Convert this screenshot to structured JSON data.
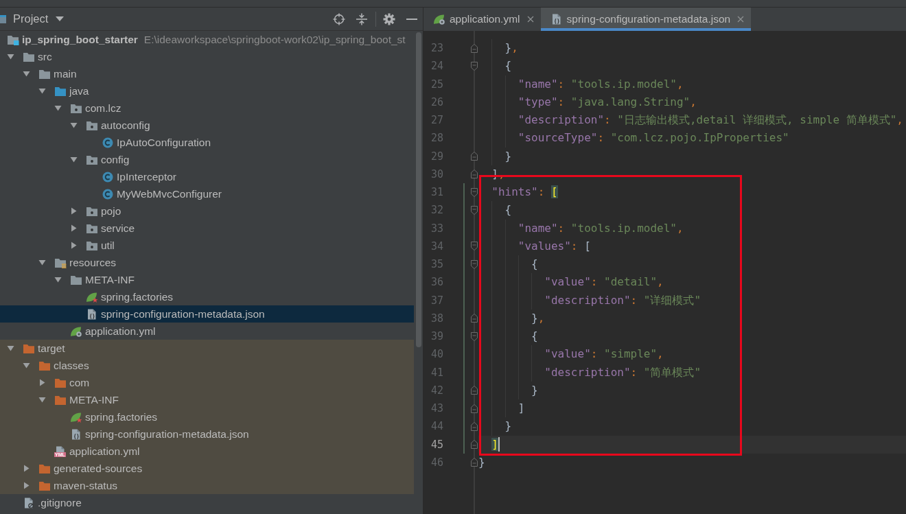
{
  "project_panel": {
    "title": "Project",
    "tools": [
      {
        "kind": "locate"
      },
      {
        "kind": "collapse"
      },
      {
        "kind": "separator"
      },
      {
        "kind": "settings"
      },
      {
        "kind": "hide"
      }
    ]
  },
  "tree": [
    {
      "kind": "module",
      "label": "ip_spring_boot_starter",
      "path": "E:\\ideaworkspace\\springboot-work02\\ip_spring_boot_st",
      "selected": false,
      "children": [
        {
          "kind": "folder",
          "label": "src",
          "expanded": true,
          "excluded": false,
          "selected": false,
          "children": [
            {
              "kind": "folder",
              "label": "main",
              "expanded": true,
              "selected": false,
              "children": [
                {
                  "kind": "source-folder",
                  "label": "java",
                  "expanded": true,
                  "selected": false,
                  "children": [
                    {
                      "kind": "package",
                      "label": "com.lcz",
                      "expanded": true,
                      "selected": false,
                      "children": [
                        {
                          "kind": "package",
                          "label": "autoconfig",
                          "expanded": true,
                          "selected": false,
                          "children": [
                            {
                              "kind": "class",
                              "label": "IpAutoConfiguration",
                              "selected": false
                            }
                          ]
                        },
                        {
                          "kind": "package",
                          "label": "config",
                          "expanded": true,
                          "selected": false,
                          "children": [
                            {
                              "kind": "class",
                              "label": "IpInterceptor",
                              "selected": false
                            },
                            {
                              "kind": "class",
                              "label": "MyWebMvcConfigurer",
                              "selected": false
                            }
                          ]
                        },
                        {
                          "kind": "package",
                          "label": "pojo",
                          "expanded": false,
                          "selected": false
                        },
                        {
                          "kind": "package",
                          "label": "service",
                          "expanded": false,
                          "selected": false
                        },
                        {
                          "kind": "package",
                          "label": "util",
                          "expanded": false,
                          "selected": false
                        }
                      ]
                    }
                  ]
                },
                {
                  "kind": "resources-folder",
                  "label": "resources",
                  "expanded": true,
                  "selected": false,
                  "children": [
                    {
                      "kind": "folder",
                      "label": "META-INF",
                      "expanded": true,
                      "selected": false,
                      "children": [
                        {
                          "kind": "spring-factories",
                          "label": "spring.factories",
                          "selected": false
                        },
                        {
                          "kind": "json",
                          "label": "spring-configuration-metadata.json",
                          "selected": true
                        }
                      ]
                    },
                    {
                      "kind": "spring-yml",
                      "label": "application.yml",
                      "selected": false
                    }
                  ]
                }
              ]
            }
          ]
        },
        {
          "kind": "excluded-folder",
          "label": "target",
          "expanded": true,
          "excluded": true,
          "selected": false,
          "children": [
            {
              "kind": "excluded-folder",
              "label": "classes",
              "expanded": true,
              "selected": false,
              "children": [
                {
                  "kind": "excluded-folder",
                  "label": "com",
                  "expanded": false,
                  "selected": false
                },
                {
                  "kind": "excluded-folder",
                  "label": "META-INF",
                  "expanded": true,
                  "selected": false,
                  "children": [
                    {
                      "kind": "spring-factories",
                      "label": "spring.factories",
                      "selected": false
                    },
                    {
                      "kind": "json",
                      "label": "spring-configuration-metadata.json",
                      "selected": false
                    }
                  ]
                },
                {
                  "kind": "yml",
                  "label": "application.yml",
                  "badge": "YML",
                  "selected": false
                }
              ]
            },
            {
              "kind": "excluded-folder",
              "label": "generated-sources",
              "expanded": false,
              "selected": false
            },
            {
              "kind": "excluded-folder",
              "label": "maven-status",
              "expanded": false,
              "selected": false
            }
          ]
        },
        {
          "kind": "gitignore",
          "label": ".gitignore",
          "excluded": false,
          "selected": false
        }
      ]
    }
  ],
  "editor": {
    "tabs": [
      {
        "label": "application.yml",
        "kind": "spring-yml",
        "selected": false
      },
      {
        "label": "spring-configuration-metadata.json",
        "kind": "json",
        "selected": true
      }
    ],
    "lines": [
      {
        "children": [
          {
            "framed": false,
            "changed": false,
            "children": [
              {
                "closing": {
                  "number": "23",
                  "current": false,
                  "tokens": [
                    {
                      "kind": "bracket",
                      "text": "}"
                    },
                    {
                      "kind": "punct",
                      "text": ","
                    }
                  ]
                }
              },
              {
                "number": "24",
                "current": false,
                "tokens": [
                  {
                    "kind": "bracket",
                    "text": "{"
                  }
                ],
                "children": [
                  {
                    "number": "25",
                    "current": false,
                    "tokens": [
                      {
                        "kind": "key",
                        "text": "\"name\""
                      },
                      {
                        "kind": "punct",
                        "text": ": "
                      },
                      {
                        "kind": "string",
                        "text": "\"tools.ip.model\""
                      },
                      {
                        "kind": "punct",
                        "text": ","
                      }
                    ]
                  },
                  {
                    "number": "26",
                    "current": false,
                    "tokens": [
                      {
                        "kind": "key",
                        "text": "\"type\""
                      },
                      {
                        "kind": "punct",
                        "text": ": "
                      },
                      {
                        "kind": "string",
                        "text": "\"java.lang.String\""
                      },
                      {
                        "kind": "punct",
                        "text": ","
                      }
                    ]
                  },
                  {
                    "number": "27",
                    "current": false,
                    "tokens": [
                      {
                        "kind": "key",
                        "text": "\"description\""
                      },
                      {
                        "kind": "punct",
                        "text": ": "
                      },
                      {
                        "kind": "string",
                        "text": "\"日志输出模式,detail 详细模式, simple 简单模式\""
                      },
                      {
                        "kind": "punct",
                        "text": ","
                      }
                    ]
                  },
                  {
                    "number": "28",
                    "current": false,
                    "tokens": [
                      {
                        "kind": "key",
                        "text": "\"sourceType\""
                      },
                      {
                        "kind": "punct",
                        "text": ": "
                      },
                      {
                        "kind": "string",
                        "text": "\"com.lcz.pojo.IpProperties\""
                      }
                    ]
                  }
                ],
                "closing": {
                  "number": "29",
                  "current": false,
                  "tokens": [
                    {
                      "kind": "bracket",
                      "text": "}"
                    }
                  ]
                }
              }
            ],
            "closing": {
              "number": "30",
              "current": false,
              "tokens": [
                {
                  "kind": "bracket",
                  "text": "]"
                },
                {
                  "kind": "punct",
                  "text": ","
                }
              ]
            }
          },
          {
            "framed": true,
            "changed": true,
            "number": "31",
            "current": false,
            "tokens": [
              {
                "kind": "key",
                "text": "\"hints\""
              },
              {
                "kind": "punct",
                "text": ": "
              },
              {
                "kind": "matched-bracket",
                "text": "["
              }
            ],
            "children": [
              {
                "number": "32",
                "current": false,
                "tokens": [
                  {
                    "kind": "bracket",
                    "text": "{"
                  }
                ],
                "children": [
                  {
                    "number": "33",
                    "current": false,
                    "tokens": [
                      {
                        "kind": "key",
                        "text": "\"name\""
                      },
                      {
                        "kind": "punct",
                        "text": ": "
                      },
                      {
                        "kind": "string",
                        "text": "\"tools.ip.model\""
                      },
                      {
                        "kind": "punct",
                        "text": ","
                      }
                    ]
                  },
                  {
                    "number": "34",
                    "current": false,
                    "tokens": [
                      {
                        "kind": "key",
                        "text": "\"values\""
                      },
                      {
                        "kind": "punct",
                        "text": ": "
                      },
                      {
                        "kind": "bracket",
                        "text": "["
                      }
                    ],
                    "children": [
                      {
                        "number": "35",
                        "current": false,
                        "tokens": [
                          {
                            "kind": "bracket",
                            "text": "{"
                          }
                        ],
                        "children": [
                          {
                            "number": "36",
                            "current": false,
                            "tokens": [
                              {
                                "kind": "key",
                                "text": "\"value\""
                              },
                              {
                                "kind": "punct",
                                "text": ": "
                              },
                              {
                                "kind": "string",
                                "text": "\"detail\""
                              },
                              {
                                "kind": "punct",
                                "text": ","
                              }
                            ]
                          },
                          {
                            "number": "37",
                            "current": false,
                            "tokens": [
                              {
                                "kind": "key",
                                "text": "\"description\""
                              },
                              {
                                "kind": "punct",
                                "text": ": "
                              },
                              {
                                "kind": "string",
                                "text": "\"详细模式\""
                              }
                            ]
                          }
                        ],
                        "closing": {
                          "number": "38",
                          "current": false,
                          "tokens": [
                            {
                              "kind": "bracket",
                              "text": "}"
                            },
                            {
                              "kind": "punct",
                              "text": ","
                            }
                          ]
                        }
                      },
                      {
                        "number": "39",
                        "current": false,
                        "tokens": [
                          {
                            "kind": "bracket",
                            "text": "{"
                          }
                        ],
                        "children": [
                          {
                            "number": "40",
                            "current": false,
                            "tokens": [
                              {
                                "kind": "key",
                                "text": "\"value\""
                              },
                              {
                                "kind": "punct",
                                "text": ": "
                              },
                              {
                                "kind": "string",
                                "text": "\"simple\""
                              },
                              {
                                "kind": "punct",
                                "text": ","
                              }
                            ]
                          },
                          {
                            "number": "41",
                            "current": false,
                            "tokens": [
                              {
                                "kind": "key",
                                "text": "\"description\""
                              },
                              {
                                "kind": "punct",
                                "text": ": "
                              },
                              {
                                "kind": "string",
                                "text": "\"简单模式\""
                              }
                            ]
                          }
                        ],
                        "closing": {
                          "number": "42",
                          "current": false,
                          "tokens": [
                            {
                              "kind": "bracket",
                              "text": "}"
                            }
                          ]
                        }
                      }
                    ],
                    "closing": {
                      "number": "43",
                      "current": false,
                      "tokens": [
                        {
                          "kind": "bracket",
                          "text": "]"
                        }
                      ]
                    }
                  }
                ],
                "closing": {
                  "number": "44",
                  "current": false,
                  "tokens": [
                    {
                      "kind": "bracket",
                      "text": "}"
                    }
                  ]
                }
              }
            ],
            "closing": {
              "number": "45",
              "current": true,
              "tokens": [
                {
                  "kind": "matched-bracket",
                  "text": "]"
                }
              ]
            }
          }
        ],
        "closing": {
          "number": "46",
          "current": false,
          "tokens": [
            {
              "kind": "bracket",
              "text": "}"
            }
          ]
        }
      }
    ]
  }
}
